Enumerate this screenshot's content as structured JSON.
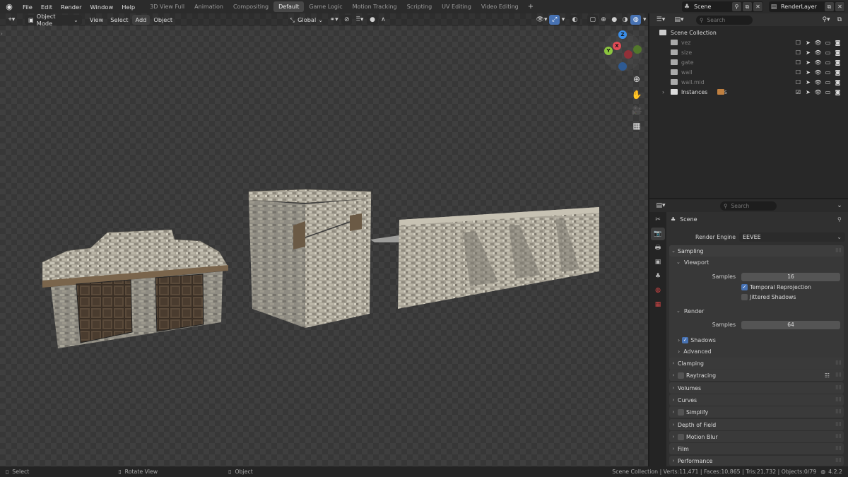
{
  "topbar": {
    "menus": [
      "File",
      "Edit",
      "Render",
      "Window",
      "Help"
    ],
    "workspaces": [
      "3D View Full",
      "Animation",
      "Compositing",
      "Default",
      "Game Logic",
      "Motion Tracking",
      "Scripting",
      "UV Editing",
      "Video Editing"
    ],
    "active_workspace": "Default",
    "scene_name": "Scene",
    "render_layer": "RenderLayer"
  },
  "viewport": {
    "mode": "Object Mode",
    "menus": [
      "View",
      "Select",
      "Add",
      "Object"
    ],
    "transform_orientation": "Global",
    "gizmo_labels": {
      "z": "Z",
      "y": "Y",
      "x": "X"
    }
  },
  "outliner": {
    "search_placeholder": "Search",
    "root": "Scene Collection",
    "collections": [
      {
        "name": "vez",
        "excluded": true
      },
      {
        "name": "size",
        "excluded": true
      },
      {
        "name": "gate",
        "excluded": true
      },
      {
        "name": "wall",
        "excluded": true
      },
      {
        "name": "wall.mid",
        "excluded": true
      },
      {
        "name": "Instances",
        "excluded": false,
        "badge": "5"
      }
    ]
  },
  "properties": {
    "search_placeholder": "Search",
    "context": "Scene",
    "render_engine_label": "Render Engine",
    "render_engine": "EEVEE",
    "sampling": "Sampling",
    "viewport_sub": "Viewport",
    "viewport_samples_label": "Samples",
    "viewport_samples": "16",
    "temporal_reprojection": "Temporal Reprojection",
    "jittered_shadows": "Jittered Shadows",
    "render_sub": "Render",
    "render_samples_label": "Samples",
    "render_samples": "64",
    "shadows": "Shadows",
    "advanced": "Advanced",
    "panels": [
      "Clamping",
      "Raytracing",
      "Volumes",
      "Curves",
      "Simplify",
      "Depth of Field",
      "Motion Blur",
      "Film",
      "Performance"
    ]
  },
  "status": {
    "select": "Select",
    "rotate": "Rotate View",
    "object": "Object",
    "stats": "Scene Collection | Verts:11,471 | Faces:10,865 | Tris:21,732 | Objects:0/79",
    "version": "4.2.2"
  },
  "colors": {
    "accent": "#4772b3",
    "x_axis": "#e04b55",
    "y_axis": "#8cc63f",
    "z_axis": "#3b8ee8"
  }
}
